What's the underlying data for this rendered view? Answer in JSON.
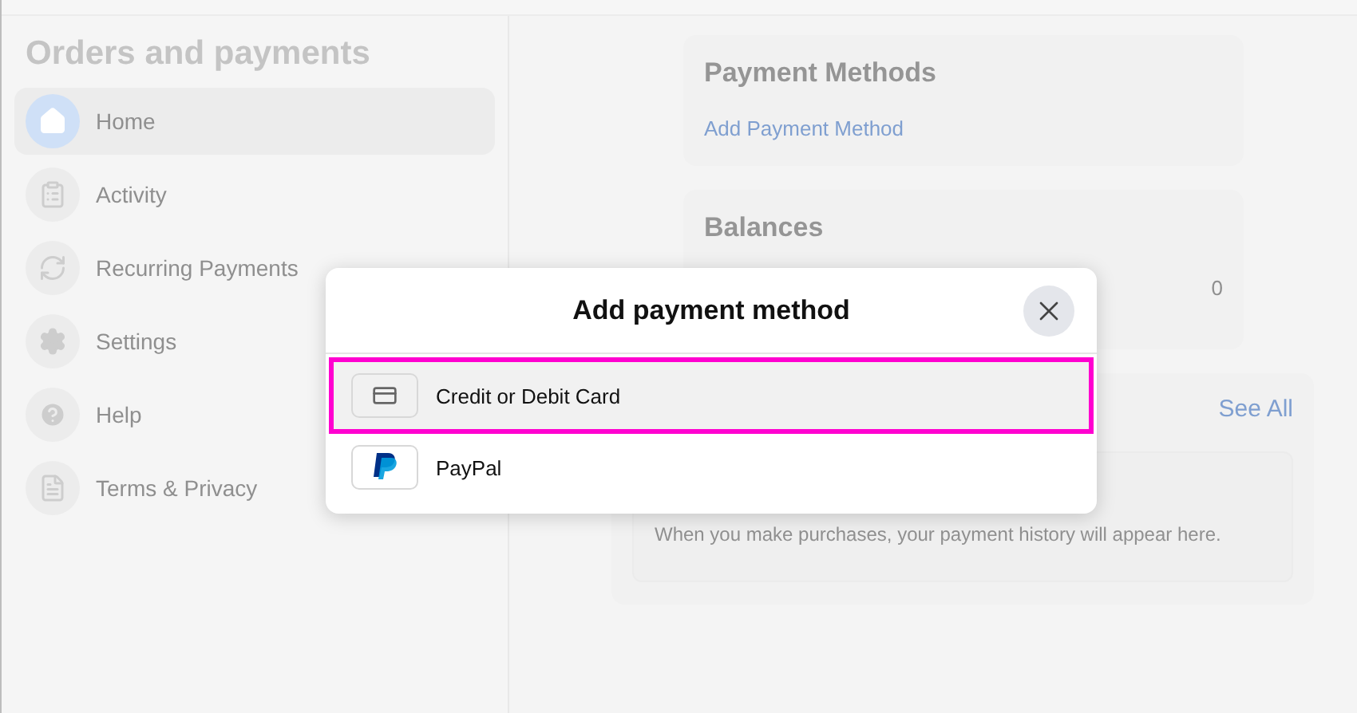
{
  "sidebar": {
    "title": "Orders and payments",
    "items": [
      {
        "label": "Home",
        "selected": true
      },
      {
        "label": "Activity",
        "selected": false
      },
      {
        "label": "Recurring Payments",
        "selected": false
      },
      {
        "label": "Settings",
        "selected": false
      },
      {
        "label": "Help",
        "selected": false
      },
      {
        "label": "Terms & Privacy",
        "selected": false
      }
    ]
  },
  "payment_methods": {
    "title": "Payment Methods",
    "link": "Add Payment Method"
  },
  "balances": {
    "title": "Balances",
    "value": "0"
  },
  "history": {
    "link": "See All",
    "empty_text": "When you make purchases, your payment history will appear here."
  },
  "dialog": {
    "title": "Add payment method",
    "options": [
      {
        "label": "Credit or Debit Card",
        "kind": "card",
        "selected": true
      },
      {
        "label": "PayPal",
        "kind": "paypal",
        "selected": false
      }
    ]
  }
}
